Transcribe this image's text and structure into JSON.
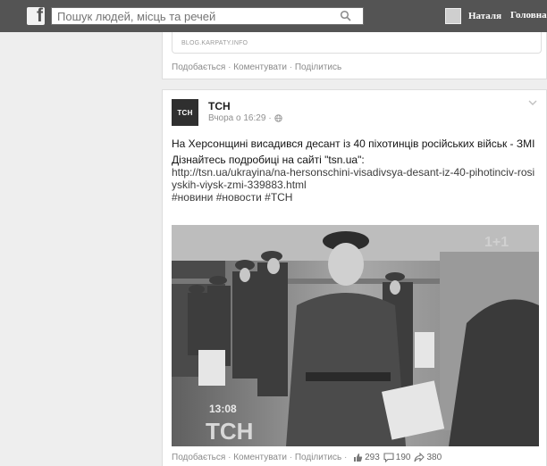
{
  "topbar": {
    "logo": "f",
    "search_placeholder": "Пошук людей, місць та речей",
    "user_name": "Наталя",
    "home_label": "Головна"
  },
  "previous_post": {
    "link_source": "BLOG.KARPATY.INFO",
    "actions": {
      "like": "Подобається",
      "comment": "Коментувати",
      "share": "Поділитись"
    }
  },
  "post": {
    "author": "ТСН",
    "avatar_text": "ТСН",
    "time": "Вчора о 16:29",
    "headline": "На Херсонщині висадився десант із 40 піхотинців російських військ - ЗМІ",
    "details_line": "Дізнайтесь подробиці на сайті \"tsn.ua\":",
    "url": "http://tsn.ua/ukrayina/na-hersonschini-visadivsya-desant-iz-40-pihotinciv-rosiyskih-viysk-zmi-339883.html",
    "hashtags": "#новини #новости #ТСН",
    "photo": {
      "time_overlay": "13:08",
      "logo_overlay": "ТСН",
      "channel_overlay": "1+1"
    },
    "actions": {
      "like": "Подобається",
      "comment": "Коментувати",
      "share": "Поділитись"
    },
    "counts": {
      "likes": "293",
      "comments": "190",
      "shares": "380"
    }
  }
}
